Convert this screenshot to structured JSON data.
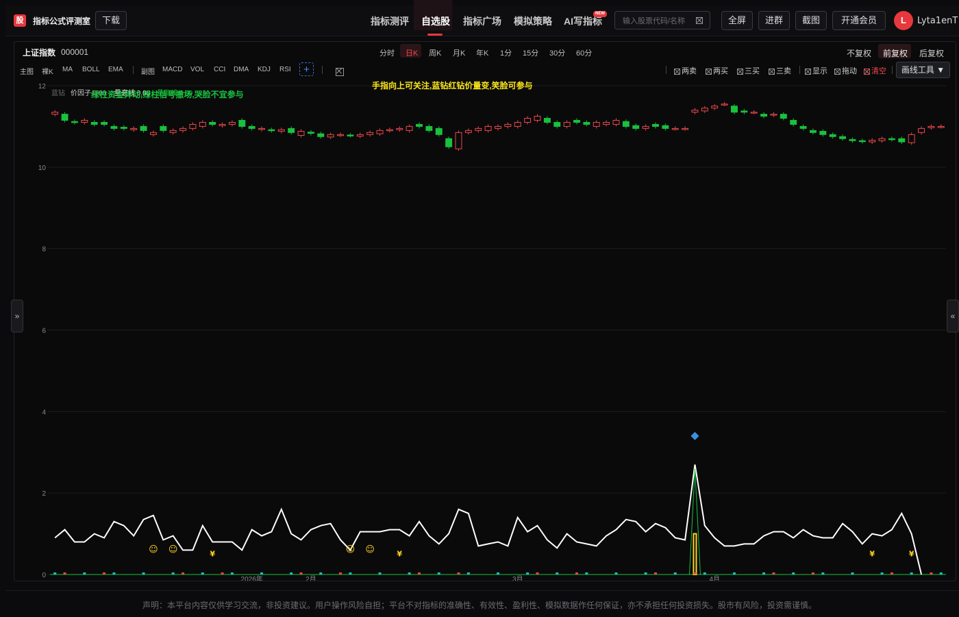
{
  "app": {
    "logo_char": "股",
    "title": "指标公式评测室",
    "download_label": "下载"
  },
  "nav": {
    "items": [
      "指标测评",
      "自选股",
      "指标广场",
      "模拟策略",
      "AI写指标"
    ],
    "active_index": 1,
    "new_badge": "NEW"
  },
  "search": {
    "placeholder": "输入股票代码/名称",
    "value": ""
  },
  "header_buttons": [
    "全屏",
    "进群",
    "截图",
    "开通会员"
  ],
  "user": {
    "avatar_letter": "L",
    "name": "Lyta1enT"
  },
  "stock": {
    "name": "上证指数",
    "code": "000001"
  },
  "periods": {
    "items": [
      "分时",
      "日K",
      "周K",
      "月K",
      "年K",
      "1分",
      "15分",
      "30分",
      "60分"
    ],
    "active_index": 1
  },
  "adjust": {
    "items": [
      "不复权",
      "前复权",
      "后复权"
    ],
    "active_index": 1
  },
  "indicator_bar": {
    "main_label": "主图",
    "main_items": [
      "裸K",
      "MA",
      "BOLL",
      "EMA"
    ],
    "sub_label": "副图",
    "sub_items": [
      "MACD",
      "VOL",
      "CCI",
      "DMA",
      "KDJ",
      "RSI"
    ],
    "add_label": "+"
  },
  "toolbar": {
    "items": [
      "两卖",
      "两买",
      "三买",
      "三卖",
      "显示",
      "拖动",
      "清空"
    ],
    "draw_tools_label": "画线工具"
  },
  "colors": {
    "up": "#f0484b",
    "down": "#19c23d",
    "accent": "#e8383d",
    "line": "#ffffff",
    "signal": "#ffd21f"
  },
  "chart_data": {
    "type": "candlestick",
    "y_axis": {
      "ticks": [
        0,
        2,
        4,
        6,
        8,
        10,
        12
      ],
      "ylim": [
        0,
        12
      ]
    },
    "x_axis": {
      "labels": [
        "2026年",
        "2月",
        "3月",
        "4月"
      ]
    },
    "legend": {
      "name": "蓝钻",
      "items": [
        "价因子 0.00",
        "量衰线 0.00",
        "量能线 0.99"
      ],
      "note_green": "绿柱资金异动,绿柱信号撤场,哭脸不宜参与",
      "note_yellow": "手指向上可关注,蓝钻红钻价量变,笑脸可参与"
    },
    "candles_close": [
      11.35,
      11.15,
      11.1,
      11.15,
      11.05,
      11.05,
      10.95,
      10.95,
      10.95,
      10.9,
      10.85,
      10.9,
      10.9,
      10.95,
      11.05,
      11.1,
      11.05,
      11.05,
      11.1,
      11.0,
      10.95,
      10.95,
      10.9,
      10.92,
      10.85,
      10.88,
      10.83,
      10.75,
      10.8,
      10.8,
      10.78,
      10.8,
      10.85,
      10.9,
      10.92,
      10.95,
      11.0,
      11.0,
      10.9,
      10.8,
      10.5,
      10.85,
      10.9,
      10.95,
      11.0,
      11.0,
      11.05,
      11.1,
      11.2,
      11.25,
      11.1,
      11.0,
      11.1,
      11.1,
      11.05,
      11.1,
      11.1,
      11.15,
      11.0,
      10.95,
      11.0,
      11.0,
      10.95,
      10.95,
      10.95,
      11.4,
      11.45,
      11.5,
      11.55,
      11.35,
      11.35,
      11.35,
      11.25,
      11.3,
      11.2,
      11.05,
      10.95,
      10.85,
      10.8,
      10.75,
      10.7,
      10.65,
      10.63,
      10.66,
      10.7,
      10.68,
      10.62,
      10.8,
      10.95,
      11.0,
      11.0
    ],
    "candles_open": [
      11.3,
      11.3,
      11.12,
      11.1,
      11.1,
      11.1,
      11.0,
      10.98,
      10.92,
      11.0,
      10.8,
      11.0,
      10.85,
      10.9,
      10.95,
      11.0,
      11.1,
      11.02,
      11.05,
      11.15,
      11.0,
      10.93,
      10.92,
      10.88,
      10.95,
      10.78,
      10.86,
      10.82,
      10.74,
      10.79,
      10.79,
      10.76,
      10.8,
      10.82,
      10.9,
      10.92,
      10.9,
      11.05,
      11.0,
      10.95,
      10.7,
      10.45,
      10.85,
      10.9,
      10.9,
      10.95,
      11.0,
      11.0,
      11.1,
      11.15,
      11.2,
      11.1,
      11.0,
      11.15,
      11.1,
      11.0,
      11.05,
      11.05,
      11.12,
      11.02,
      10.95,
      11.05,
      11.02,
      10.95,
      10.95,
      11.35,
      11.38,
      11.45,
      11.55,
      11.5,
      11.38,
      11.35,
      11.3,
      11.28,
      11.3,
      11.15,
      11.0,
      10.9,
      10.88,
      10.8,
      10.75,
      10.68,
      10.65,
      10.62,
      10.65,
      10.7,
      10.7,
      10.6,
      10.85,
      10.97,
      11.0
    ],
    "series": [
      {
        "name": "量衰线",
        "type": "line",
        "values": [
          0.9,
          1.1,
          0.8,
          0.8,
          1.0,
          0.9,
          1.3,
          1.2,
          0.95,
          1.35,
          1.45,
          0.85,
          0.95,
          0.6,
          0.6,
          1.2,
          0.8,
          0.8,
          0.8,
          0.6,
          1.1,
          0.95,
          1.05,
          1.6,
          1.0,
          0.85,
          1.1,
          1.2,
          1.25,
          0.85,
          0.6,
          1.05,
          1.05,
          1.05,
          1.1,
          1.1,
          0.95,
          1.3,
          0.95,
          0.75,
          1.0,
          1.6,
          1.5,
          0.7,
          0.75,
          0.8,
          0.7,
          1.4,
          1.05,
          1.2,
          0.85,
          0.65,
          1.0,
          0.8,
          0.75,
          0.7,
          0.95,
          1.1,
          1.35,
          1.3,
          1.05,
          1.25,
          1.15,
          0.9,
          0.85,
          2.7,
          1.2,
          0.9,
          0.7,
          0.7,
          0.75,
          0.75,
          0.95,
          1.05,
          1.05,
          0.9,
          1.1,
          0.95,
          0.9,
          0.9,
          1.25,
          1.05,
          0.75,
          1.0,
          0.95,
          1.1,
          1.5,
          1.0,
          0.0
        ]
      },
      {
        "name": "资金异动",
        "type": "bar",
        "values": [
          0,
          0,
          0,
          0,
          0,
          0,
          0,
          0,
          0,
          0,
          0,
          0,
          0,
          0,
          0,
          0,
          0,
          0,
          0,
          0,
          0,
          0,
          0,
          0,
          0,
          0,
          0,
          0,
          0,
          0,
          0,
          0,
          0,
          0,
          0,
          0,
          0,
          0,
          0,
          0,
          0,
          0,
          0,
          0,
          0,
          0,
          0,
          0,
          0,
          0,
          0,
          0,
          0,
          0,
          0,
          0,
          0,
          0,
          0,
          0,
          0,
          0,
          0,
          0,
          0,
          1.0,
          0,
          0,
          0,
          0,
          0,
          0,
          0,
          0,
          0,
          0,
          0,
          0,
          0,
          0,
          0,
          0,
          0,
          0,
          0,
          0,
          0,
          0,
          0
        ]
      }
    ],
    "markers": {
      "smiley_indices": [
        10,
        12,
        30,
        32
      ],
      "yuan_indices": [
        16,
        35,
        83,
        87
      ],
      "diamond_index": 65,
      "diamond_value": 3.4,
      "smiley": "☺",
      "yuan": "¥"
    }
  },
  "disclaimer": "声明：本平台内容仅供学习交流，非投资建议。用户操作风险自担；平台不对指标的准确性、有效性、盈利性、模拟数据作任何保证，亦不承担任何投资损失。股市有风险，投资需谨慎。"
}
